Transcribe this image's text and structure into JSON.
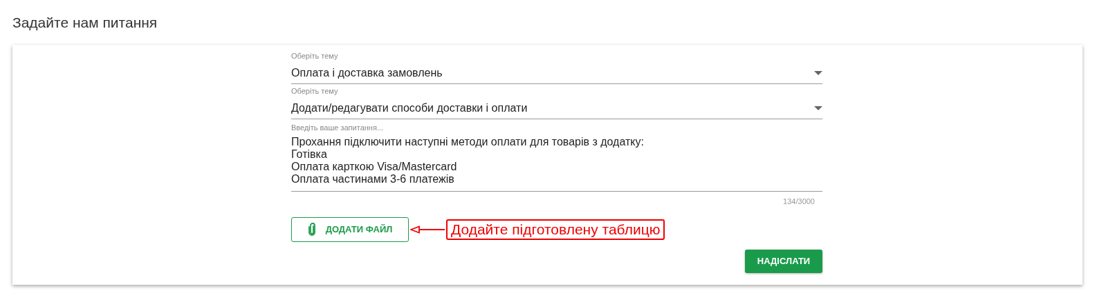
{
  "title": "Задайте нам питання",
  "selects": [
    {
      "label": "Оберіть тему",
      "value": "Оплата і доставка замовлень"
    },
    {
      "label": "Оберіть тему",
      "value": "Додати/редагувати способи доставки і оплати"
    }
  ],
  "question": {
    "placeholder": "Введіть ваше запитання...",
    "lines": [
      "Прохання підключити наступні методи оплати для товарів з додатку:",
      "Готівка",
      "Оплата карткою Visa/Mastercard",
      "Оплата частинами 3-6 платежів"
    ],
    "counter": "134/3000"
  },
  "attach_button": "ДОДАТИ ФАЙЛ",
  "annotation": "Додайте підготовлену таблицю",
  "submit_button": "НАДІСЛАТИ"
}
